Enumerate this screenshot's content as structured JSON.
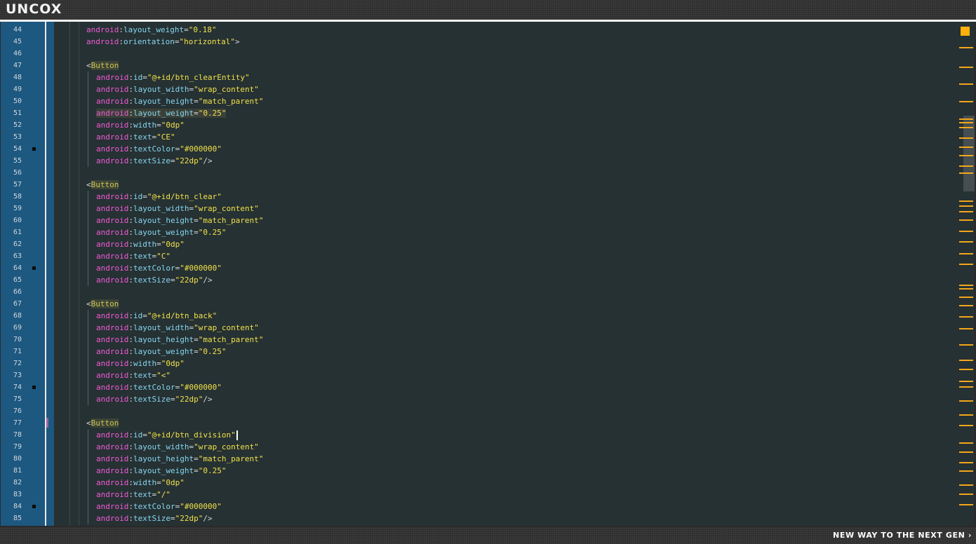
{
  "app": {
    "brand": "UNCOX",
    "tagline": "NEW WAY TO THE NEXT GEN ›"
  },
  "colors": {
    "namespace": "#f05ad7",
    "attribute": "#86d6f0",
    "value": "#f0e14a",
    "tag": "#d0c454",
    "gutter": "#1d5880",
    "editor_bg": "#263133",
    "minimap_marker": "#f3a61a"
  },
  "editor": {
    "caret_line": 78,
    "lines": [
      {
        "n": "44",
        "kind": "attr",
        "ns": "android",
        "attr": "layout_weight",
        "val": "0.18",
        "tail": ""
      },
      {
        "n": "45",
        "kind": "attr",
        "ns": "android",
        "attr": "orientation",
        "val": "horizontal",
        "tail": ">"
      },
      {
        "n": "46",
        "kind": "blank"
      },
      {
        "n": "47",
        "kind": "tag",
        "tag": "Button"
      },
      {
        "n": "48",
        "kind": "attr",
        "ns": "android",
        "attr": "id",
        "val": "@+id/btn_clearEntity",
        "tail": ""
      },
      {
        "n": "49",
        "kind": "attr",
        "ns": "android",
        "attr": "layout_width",
        "val": "wrap_content",
        "tail": ""
      },
      {
        "n": "50",
        "kind": "attr",
        "ns": "android",
        "attr": "layout_height",
        "val": "match_parent",
        "tail": ""
      },
      {
        "n": "51",
        "kind": "attr",
        "ns": "android",
        "attr": "layout_weight",
        "val": "0.25",
        "tail": "",
        "highlight": true
      },
      {
        "n": "52",
        "kind": "attr",
        "ns": "android",
        "attr": "width",
        "val": "0dp",
        "tail": ""
      },
      {
        "n": "53",
        "kind": "attr",
        "ns": "android",
        "attr": "text",
        "val": "CE",
        "tail": ""
      },
      {
        "n": "54",
        "kind": "attr",
        "ns": "android",
        "attr": "textColor",
        "val": "#000000",
        "tail": "",
        "mark": true
      },
      {
        "n": "55",
        "kind": "attr",
        "ns": "android",
        "attr": "textSize",
        "val": "22dp",
        "tail": "/>"
      },
      {
        "n": "56",
        "kind": "blank"
      },
      {
        "n": "57",
        "kind": "tag",
        "tag": "Button"
      },
      {
        "n": "58",
        "kind": "attr",
        "ns": "android",
        "attr": "id",
        "val": "@+id/btn_clear",
        "tail": ""
      },
      {
        "n": "59",
        "kind": "attr",
        "ns": "android",
        "attr": "layout_width",
        "val": "wrap_content",
        "tail": ""
      },
      {
        "n": "60",
        "kind": "attr",
        "ns": "android",
        "attr": "layout_height",
        "val": "match_parent",
        "tail": ""
      },
      {
        "n": "61",
        "kind": "attr",
        "ns": "android",
        "attr": "layout_weight",
        "val": "0.25",
        "tail": ""
      },
      {
        "n": "62",
        "kind": "attr",
        "ns": "android",
        "attr": "width",
        "val": "0dp",
        "tail": ""
      },
      {
        "n": "63",
        "kind": "attr",
        "ns": "android",
        "attr": "text",
        "val": "C",
        "tail": ""
      },
      {
        "n": "64",
        "kind": "attr",
        "ns": "android",
        "attr": "textColor",
        "val": "#000000",
        "tail": "",
        "mark": true
      },
      {
        "n": "65",
        "kind": "attr",
        "ns": "android",
        "attr": "textSize",
        "val": "22dp",
        "tail": "/>"
      },
      {
        "n": "66",
        "kind": "blank"
      },
      {
        "n": "67",
        "kind": "tag",
        "tag": "Button"
      },
      {
        "n": "68",
        "kind": "attr",
        "ns": "android",
        "attr": "id",
        "val": "@+id/btn_back",
        "tail": ""
      },
      {
        "n": "69",
        "kind": "attr",
        "ns": "android",
        "attr": "layout_width",
        "val": "wrap_content",
        "tail": ""
      },
      {
        "n": "70",
        "kind": "attr",
        "ns": "android",
        "attr": "layout_height",
        "val": "match_parent",
        "tail": ""
      },
      {
        "n": "71",
        "kind": "attr",
        "ns": "android",
        "attr": "layout_weight",
        "val": "0.25",
        "tail": ""
      },
      {
        "n": "72",
        "kind": "attr",
        "ns": "android",
        "attr": "width",
        "val": "0dp",
        "tail": ""
      },
      {
        "n": "73",
        "kind": "attr",
        "ns": "android",
        "attr": "text",
        "val": "<",
        "tail": ""
      },
      {
        "n": "74",
        "kind": "attr",
        "ns": "android",
        "attr": "textColor",
        "val": "#000000",
        "tail": "",
        "mark": true
      },
      {
        "n": "75",
        "kind": "attr",
        "ns": "android",
        "attr": "textSize",
        "val": "22dp",
        "tail": "/>"
      },
      {
        "n": "76",
        "kind": "blank"
      },
      {
        "n": "77",
        "kind": "tag",
        "tag": "Button",
        "modified": true
      },
      {
        "n": "78",
        "kind": "attr",
        "ns": "android",
        "attr": "id",
        "val": "@+id/btn_division",
        "tail": "",
        "caret": true
      },
      {
        "n": "79",
        "kind": "attr",
        "ns": "android",
        "attr": "layout_width",
        "val": "wrap_content",
        "tail": ""
      },
      {
        "n": "80",
        "kind": "attr",
        "ns": "android",
        "attr": "layout_height",
        "val": "match_parent",
        "tail": ""
      },
      {
        "n": "81",
        "kind": "attr",
        "ns": "android",
        "attr": "layout_weight",
        "val": "0.25",
        "tail": ""
      },
      {
        "n": "82",
        "kind": "attr",
        "ns": "android",
        "attr": "width",
        "val": "0dp",
        "tail": ""
      },
      {
        "n": "83",
        "kind": "attr",
        "ns": "android",
        "attr": "text",
        "val": "/",
        "tail": ""
      },
      {
        "n": "84",
        "kind": "attr",
        "ns": "android",
        "attr": "textColor",
        "val": "#000000",
        "tail": "",
        "mark": true
      },
      {
        "n": "85",
        "kind": "attr",
        "ns": "android",
        "attr": "textSize",
        "val": "22dp",
        "tail": "/>"
      }
    ]
  }
}
